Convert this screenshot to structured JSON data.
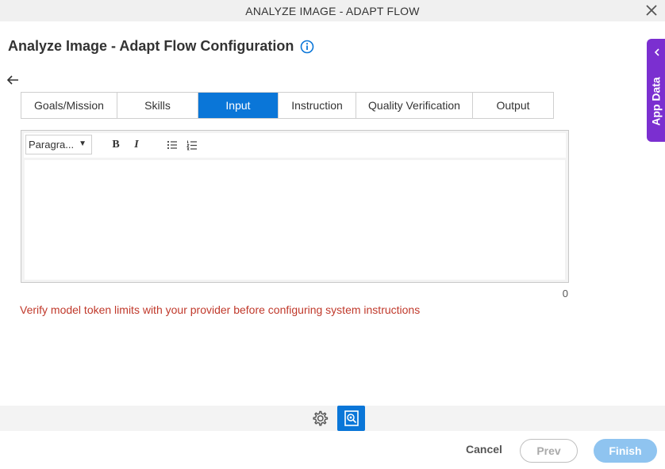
{
  "window": {
    "title": "ANALYZE IMAGE - ADAPT FLOW"
  },
  "page": {
    "heading": "Analyze Image - Adapt Flow Configuration"
  },
  "tabs": [
    {
      "label": "Goals/Mission",
      "active": false
    },
    {
      "label": "Skills",
      "active": false
    },
    {
      "label": "Input",
      "active": true
    },
    {
      "label": "Instruction",
      "active": false
    },
    {
      "label": "Quality Verification",
      "active": false
    },
    {
      "label": "Output",
      "active": false
    }
  ],
  "editor": {
    "format_selected": "Paragra...",
    "bold_label": "B",
    "italic_label": "I",
    "content": "",
    "char_count": "0"
  },
  "warning": "Verify model token limits with your provider before configuring system instructions",
  "footer": {
    "cancel_label": "Cancel",
    "prev_label": "Prev",
    "finish_label": "Finish"
  },
  "side_panel": {
    "label": "App Data"
  },
  "colors": {
    "accent": "#0a76d8",
    "panel_purple": "#7b2fd0",
    "warning_red": "#c0392b",
    "finish_disabled": "#8fc4f0"
  },
  "icons": [
    "close-icon",
    "info-icon",
    "back-arrow-icon",
    "bullet-list-icon",
    "numbered-list-icon",
    "gear-icon",
    "image-scan-icon",
    "chevron-left-icon"
  ]
}
